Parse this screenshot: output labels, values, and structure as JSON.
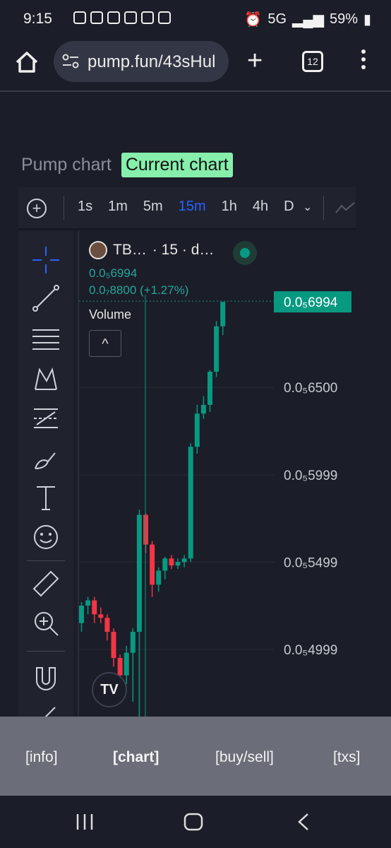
{
  "statusbar": {
    "time": "9:15",
    "network": "5G",
    "battery": "59%"
  },
  "browser": {
    "url": "pump.fun/43sHul",
    "tab_count": "12"
  },
  "chart_tabs": {
    "pump": "Pump chart",
    "current": "Current chart"
  },
  "tradingview": {
    "intervals": [
      "1s",
      "1m",
      "5m",
      "15m",
      "1h",
      "4h",
      "D"
    ],
    "active_interval": "15m",
    "legend_symbol": "TB…",
    "legend_meta": "· 15 · d…",
    "ohlc_line1": "0.0₅6994",
    "ohlc_line2": "0.0₇8800 (+1.27%)",
    "volume_label": "Volume",
    "collapse_glyph": "^",
    "last_price": "0.0₅6994",
    "price_levels": [
      "0.0₅6500",
      "0.0₅5999",
      "0.0₅5499",
      "0.0₅4999"
    ],
    "logo_text": "TV"
  },
  "chart_data": {
    "type": "candlestick",
    "series": [
      {
        "name": "",
        "candles": [
          {
            "o": 5.15e-06,
            "c": 5.25e-06,
            "h": 5.27e-06,
            "l": 5.1e-06
          },
          {
            "o": 5.25e-06,
            "c": 5.28e-06,
            "h": 5.3e-06,
            "l": 5.2e-06
          },
          {
            "o": 5.28e-06,
            "c": 5.2e-06,
            "h": 5.3e-06,
            "l": 5.15e-06
          },
          {
            "o": 5.2e-06,
            "c": 5.18e-06,
            "h": 5.24e-06,
            "l": 5.15e-06
          },
          {
            "o": 5.18e-06,
            "c": 5.1e-06,
            "h": 5.2e-06,
            "l": 5.05e-06
          },
          {
            "o": 5.1e-06,
            "c": 4.95e-06,
            "h": 5.12e-06,
            "l": 4.9e-06
          },
          {
            "o": 4.95e-06,
            "c": 4.85e-06,
            "h": 4.97e-06,
            "l": 4.78e-06
          },
          {
            "o": 4.85e-06,
            "c": 4.98e-06,
            "h": 5.02e-06,
            "l": 4.8e-06
          },
          {
            "o": 4.98e-06,
            "c": 5.1e-06,
            "h": 5.12e-06,
            "l": 4.7e-06
          },
          {
            "o": 5.1e-06,
            "c": 5.77e-06,
            "h": 5.8e-06,
            "l": 4.4e-06
          },
          {
            "o": 5.77e-06,
            "c": 5.6e-06,
            "h": 5.78e-06,
            "l": 5.55e-06
          },
          {
            "o": 5.6e-06,
            "c": 5.37e-06,
            "h": 5.62e-06,
            "l": 5.3e-06
          },
          {
            "o": 5.37e-06,
            "c": 5.45e-06,
            "h": 5.47e-06,
            "l": 5.33e-06
          },
          {
            "o": 5.45e-06,
            "c": 5.52e-06,
            "h": 5.53e-06,
            "l": 5.4e-06
          },
          {
            "o": 5.52e-06,
            "c": 5.48e-06,
            "h": 5.54e-06,
            "l": 5.46e-06
          },
          {
            "o": 5.48e-06,
            "c": 5.5e-06,
            "h": 5.52e-06,
            "l": 5.46e-06
          },
          {
            "o": 5.5e-06,
            "c": 5.52e-06,
            "h": 5.54e-06,
            "l": 5.47e-06
          },
          {
            "o": 5.52e-06,
            "c": 6.16e-06,
            "h": 6.18e-06,
            "l": 5.5e-06
          },
          {
            "o": 6.16e-06,
            "c": 6.35e-06,
            "h": 6.4e-06,
            "l": 6.12e-06
          },
          {
            "o": 6.35e-06,
            "c": 6.4e-06,
            "h": 6.45e-06,
            "l": 6.32e-06
          },
          {
            "o": 6.4e-06,
            "c": 6.59e-06,
            "h": 6.6e-06,
            "l": 6.36e-06
          },
          {
            "o": 6.59e-06,
            "c": 6.85e-06,
            "h": 6.88e-06,
            "l": 6.56e-06
          },
          {
            "o": 6.85e-06,
            "c": 6.99e-06,
            "h": 6.99e-06,
            "l": 6.8e-06
          }
        ]
      }
    ],
    "ylim": [
      4.4e-06,
      7.1e-06
    ],
    "y_ticks": [
      6.5e-06,
      5.999e-06,
      5.499e-06,
      4.999e-06
    ],
    "last_value": 6.994e-06,
    "colors": {
      "up": "#089981",
      "down": "#f23645",
      "pricetag": "#089981"
    }
  },
  "bottom_nav": {
    "info": "[info]",
    "chart": "[chart]",
    "buysell": "[buy/sell]",
    "txs": "[txs]"
  }
}
